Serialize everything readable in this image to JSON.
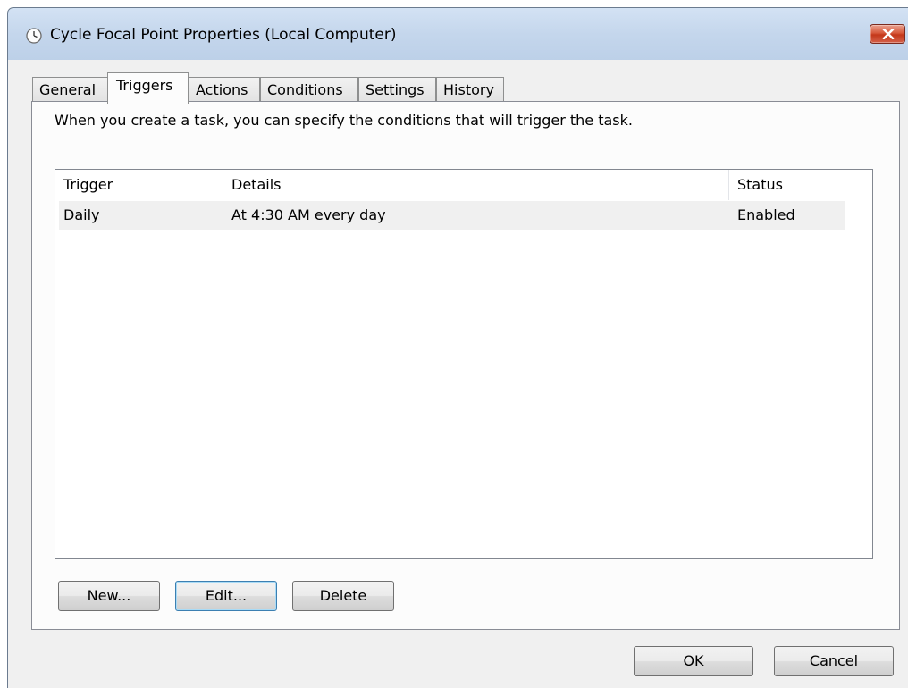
{
  "window": {
    "title": "Cycle Focal Point Properties (Local Computer)",
    "title_icon": "clock-icon",
    "close_icon": "close-icon"
  },
  "tabs": [
    {
      "label": "General",
      "active": false
    },
    {
      "label": "Triggers",
      "active": true
    },
    {
      "label": "Actions",
      "active": false
    },
    {
      "label": "Conditions",
      "active": false
    },
    {
      "label": "Settings",
      "active": false
    },
    {
      "label": "History",
      "active": false
    }
  ],
  "triggers_panel": {
    "description": "When you create a task, you can specify the conditions that will trigger the task.",
    "columns": [
      "Trigger",
      "Details",
      "Status"
    ],
    "rows": [
      {
        "trigger": "Daily",
        "details": "At 4:30 AM every day",
        "status": "Enabled"
      }
    ],
    "buttons": {
      "new": "New...",
      "edit": "Edit...",
      "delete": "Delete"
    }
  },
  "footer": {
    "ok": "OK",
    "cancel": "Cancel"
  }
}
